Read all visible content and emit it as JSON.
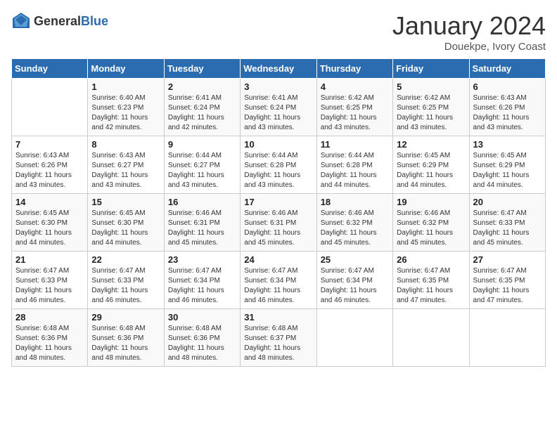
{
  "header": {
    "logo_general": "General",
    "logo_blue": "Blue",
    "month_title": "January 2024",
    "subtitle": "Douekpe, Ivory Coast"
  },
  "weekdays": [
    "Sunday",
    "Monday",
    "Tuesday",
    "Wednesday",
    "Thursday",
    "Friday",
    "Saturday"
  ],
  "weeks": [
    [
      {
        "day": "",
        "sunrise": "",
        "sunset": "",
        "daylight": ""
      },
      {
        "day": "1",
        "sunrise": "Sunrise: 6:40 AM",
        "sunset": "Sunset: 6:23 PM",
        "daylight": "Daylight: 11 hours and 42 minutes."
      },
      {
        "day": "2",
        "sunrise": "Sunrise: 6:41 AM",
        "sunset": "Sunset: 6:24 PM",
        "daylight": "Daylight: 11 hours and 42 minutes."
      },
      {
        "day": "3",
        "sunrise": "Sunrise: 6:41 AM",
        "sunset": "Sunset: 6:24 PM",
        "daylight": "Daylight: 11 hours and 43 minutes."
      },
      {
        "day": "4",
        "sunrise": "Sunrise: 6:42 AM",
        "sunset": "Sunset: 6:25 PM",
        "daylight": "Daylight: 11 hours and 43 minutes."
      },
      {
        "day": "5",
        "sunrise": "Sunrise: 6:42 AM",
        "sunset": "Sunset: 6:25 PM",
        "daylight": "Daylight: 11 hours and 43 minutes."
      },
      {
        "day": "6",
        "sunrise": "Sunrise: 6:43 AM",
        "sunset": "Sunset: 6:26 PM",
        "daylight": "Daylight: 11 hours and 43 minutes."
      }
    ],
    [
      {
        "day": "7",
        "sunrise": "Sunrise: 6:43 AM",
        "sunset": "Sunset: 6:26 PM",
        "daylight": "Daylight: 11 hours and 43 minutes."
      },
      {
        "day": "8",
        "sunrise": "Sunrise: 6:43 AM",
        "sunset": "Sunset: 6:27 PM",
        "daylight": "Daylight: 11 hours and 43 minutes."
      },
      {
        "day": "9",
        "sunrise": "Sunrise: 6:44 AM",
        "sunset": "Sunset: 6:27 PM",
        "daylight": "Daylight: 11 hours and 43 minutes."
      },
      {
        "day": "10",
        "sunrise": "Sunrise: 6:44 AM",
        "sunset": "Sunset: 6:28 PM",
        "daylight": "Daylight: 11 hours and 43 minutes."
      },
      {
        "day": "11",
        "sunrise": "Sunrise: 6:44 AM",
        "sunset": "Sunset: 6:28 PM",
        "daylight": "Daylight: 11 hours and 44 minutes."
      },
      {
        "day": "12",
        "sunrise": "Sunrise: 6:45 AM",
        "sunset": "Sunset: 6:29 PM",
        "daylight": "Daylight: 11 hours and 44 minutes."
      },
      {
        "day": "13",
        "sunrise": "Sunrise: 6:45 AM",
        "sunset": "Sunset: 6:29 PM",
        "daylight": "Daylight: 11 hours and 44 minutes."
      }
    ],
    [
      {
        "day": "14",
        "sunrise": "Sunrise: 6:45 AM",
        "sunset": "Sunset: 6:30 PM",
        "daylight": "Daylight: 11 hours and 44 minutes."
      },
      {
        "day": "15",
        "sunrise": "Sunrise: 6:45 AM",
        "sunset": "Sunset: 6:30 PM",
        "daylight": "Daylight: 11 hours and 44 minutes."
      },
      {
        "day": "16",
        "sunrise": "Sunrise: 6:46 AM",
        "sunset": "Sunset: 6:31 PM",
        "daylight": "Daylight: 11 hours and 45 minutes."
      },
      {
        "day": "17",
        "sunrise": "Sunrise: 6:46 AM",
        "sunset": "Sunset: 6:31 PM",
        "daylight": "Daylight: 11 hours and 45 minutes."
      },
      {
        "day": "18",
        "sunrise": "Sunrise: 6:46 AM",
        "sunset": "Sunset: 6:32 PM",
        "daylight": "Daylight: 11 hours and 45 minutes."
      },
      {
        "day": "19",
        "sunrise": "Sunrise: 6:46 AM",
        "sunset": "Sunset: 6:32 PM",
        "daylight": "Daylight: 11 hours and 45 minutes."
      },
      {
        "day": "20",
        "sunrise": "Sunrise: 6:47 AM",
        "sunset": "Sunset: 6:33 PM",
        "daylight": "Daylight: 11 hours and 45 minutes."
      }
    ],
    [
      {
        "day": "21",
        "sunrise": "Sunrise: 6:47 AM",
        "sunset": "Sunset: 6:33 PM",
        "daylight": "Daylight: 11 hours and 46 minutes."
      },
      {
        "day": "22",
        "sunrise": "Sunrise: 6:47 AM",
        "sunset": "Sunset: 6:33 PM",
        "daylight": "Daylight: 11 hours and 46 minutes."
      },
      {
        "day": "23",
        "sunrise": "Sunrise: 6:47 AM",
        "sunset": "Sunset: 6:34 PM",
        "daylight": "Daylight: 11 hours and 46 minutes."
      },
      {
        "day": "24",
        "sunrise": "Sunrise: 6:47 AM",
        "sunset": "Sunset: 6:34 PM",
        "daylight": "Daylight: 11 hours and 46 minutes."
      },
      {
        "day": "25",
        "sunrise": "Sunrise: 6:47 AM",
        "sunset": "Sunset: 6:34 PM",
        "daylight": "Daylight: 11 hours and 46 minutes."
      },
      {
        "day": "26",
        "sunrise": "Sunrise: 6:47 AM",
        "sunset": "Sunset: 6:35 PM",
        "daylight": "Daylight: 11 hours and 47 minutes."
      },
      {
        "day": "27",
        "sunrise": "Sunrise: 6:47 AM",
        "sunset": "Sunset: 6:35 PM",
        "daylight": "Daylight: 11 hours and 47 minutes."
      }
    ],
    [
      {
        "day": "28",
        "sunrise": "Sunrise: 6:48 AM",
        "sunset": "Sunset: 6:36 PM",
        "daylight": "Daylight: 11 hours and 48 minutes."
      },
      {
        "day": "29",
        "sunrise": "Sunrise: 6:48 AM",
        "sunset": "Sunset: 6:36 PM",
        "daylight": "Daylight: 11 hours and 48 minutes."
      },
      {
        "day": "30",
        "sunrise": "Sunrise: 6:48 AM",
        "sunset": "Sunset: 6:36 PM",
        "daylight": "Daylight: 11 hours and 48 minutes."
      },
      {
        "day": "31",
        "sunrise": "Sunrise: 6:48 AM",
        "sunset": "Sunset: 6:37 PM",
        "daylight": "Daylight: 11 hours and 48 minutes."
      },
      {
        "day": "",
        "sunrise": "",
        "sunset": "",
        "daylight": ""
      },
      {
        "day": "",
        "sunrise": "",
        "sunset": "",
        "daylight": ""
      },
      {
        "day": "",
        "sunrise": "",
        "sunset": "",
        "daylight": ""
      }
    ]
  ]
}
